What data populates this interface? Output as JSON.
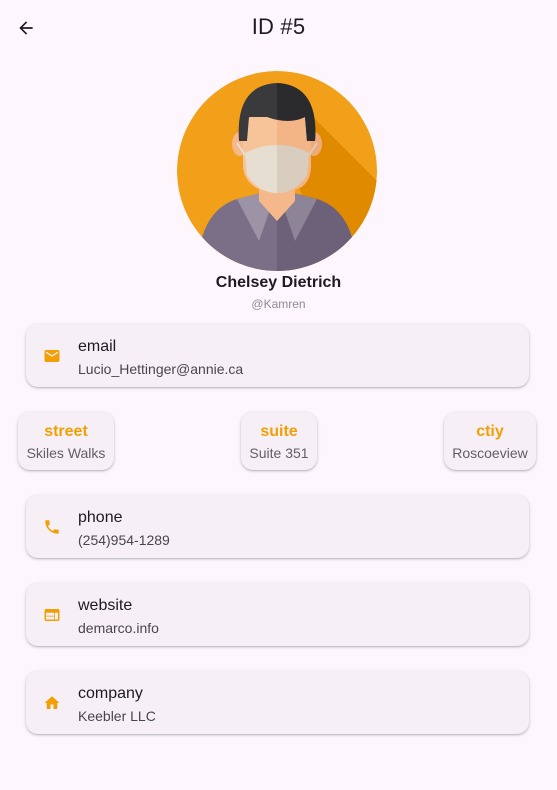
{
  "appbar": {
    "title": "ID #5",
    "back_icon": "arrow-left-icon"
  },
  "user": {
    "name": "Chelsey Dietrich",
    "username": "@Kamren",
    "avatar_icon": "user-avatar-mask-icon"
  },
  "email": {
    "label": "email",
    "value": "Lucio_Hettinger@annie.ca",
    "icon": "mail-icon"
  },
  "address": {
    "street": {
      "label": "street",
      "value": "Skiles Walks"
    },
    "suite": {
      "label": "suite",
      "value": "Suite 351"
    },
    "city": {
      "label": "ctiy",
      "value": "Roscoeview"
    }
  },
  "phone": {
    "label": "phone",
    "value": "(254)954-1289",
    "icon": "phone-icon"
  },
  "website": {
    "label": "website",
    "value": "demarco.info",
    "icon": "web-icon"
  },
  "company": {
    "label": "company",
    "value": "Keebler LLC",
    "icon": "home-icon"
  },
  "colors": {
    "accent": "#f29f05",
    "background": "#fdf7fd",
    "card": "#f6f0f6"
  }
}
